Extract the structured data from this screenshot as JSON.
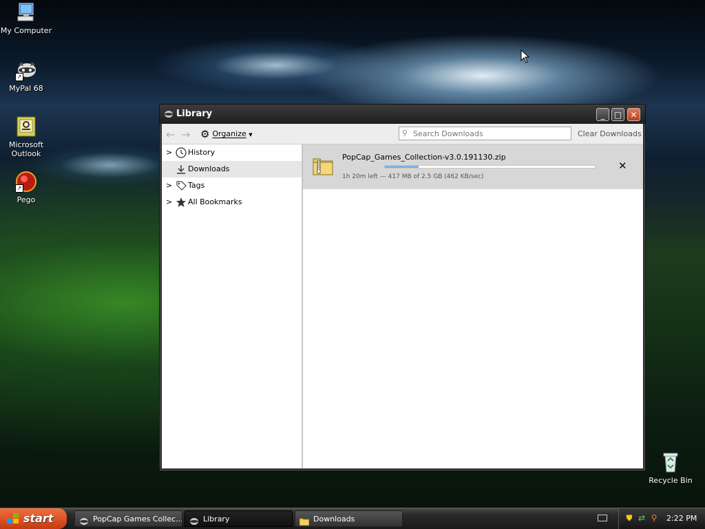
{
  "desktop": {
    "icons": [
      {
        "label": "My Computer",
        "icon": "computer-icon"
      },
      {
        "label": "MyPal 68",
        "icon": "mypal-raccoon-icon"
      },
      {
        "label": "Microsoft Outlook",
        "icon": "outlook-icon"
      },
      {
        "label": "Pego",
        "icon": "pego-icon"
      },
      {
        "label": "Recycle Bin",
        "icon": "recycle-bin-icon"
      }
    ]
  },
  "window": {
    "title": "Library",
    "controls": {
      "minimize": "_",
      "maximize": "□",
      "close": "✕"
    }
  },
  "toolbar": {
    "back": "←",
    "forward": "→",
    "organize_label": "Organize",
    "search_placeholder": "Search Downloads",
    "clear_label": "Clear Downloads"
  },
  "sidebar": {
    "items": [
      {
        "label": "History",
        "icon": "clock-icon",
        "expandable": true,
        "selected": false
      },
      {
        "label": "Downloads",
        "icon": "download-arrow-icon",
        "expandable": false,
        "selected": true
      },
      {
        "label": "Tags",
        "icon": "tag-icon",
        "expandable": true,
        "selected": false
      },
      {
        "label": "All Bookmarks",
        "icon": "star-icon",
        "expandable": true,
        "selected": false
      }
    ]
  },
  "downloads": [
    {
      "filename": "PopCap_Games_Collection-v3.0.191130.zip",
      "status": "1h 20m left — 417 MB of 2.5 GB (462 KB/sec)",
      "progress": 0.16,
      "cancel": "✕"
    }
  ],
  "taskbar": {
    "start_label": "start",
    "tasks": [
      {
        "label": "PopCap Games Collec...",
        "icon": "mypal-raccoon-icon",
        "active": false
      },
      {
        "label": "Library",
        "icon": "mypal-raccoon-icon",
        "active": true
      },
      {
        "label": "Downloads",
        "icon": "folder-icon",
        "active": false
      }
    ],
    "clock": "2:22 PM"
  }
}
